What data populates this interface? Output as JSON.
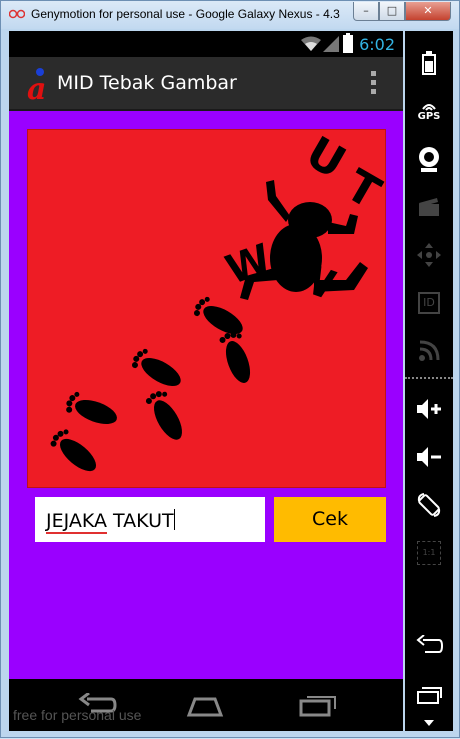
{
  "window": {
    "title": "Genymotion for personal use - Google Galaxy Nexus - 4.3",
    "min_label": "–",
    "max_label": "□",
    "close_label": "✕"
  },
  "statusbar": {
    "time": "6:02",
    "accent_color": "#33b5e5"
  },
  "actionbar": {
    "app_title": "MID Tebak Gambar",
    "logo_letter": "a"
  },
  "content": {
    "background_color": "#9a00ff",
    "picture_background": "#ee1c25",
    "picture_letters": [
      "U",
      "T",
      "W",
      "W"
    ],
    "answer_text_misspelled": "JEJAKA",
    "answer_text_rest": " TAKUT",
    "check_button_label": "Cek",
    "check_button_color": "#ffbb00"
  },
  "navbar": {
    "buttons": [
      "back-icon",
      "home-icon",
      "recent-apps-icon"
    ]
  },
  "watermark": "free for personal use",
  "sidebar": {
    "items": [
      {
        "icon": "battery-icon"
      },
      {
        "icon": "gps-icon",
        "label": "GPS"
      },
      {
        "icon": "camera-icon"
      },
      {
        "icon": "clapperboard-icon"
      },
      {
        "icon": "dpad-icon"
      },
      {
        "icon": "id-icon",
        "label": "ID"
      },
      {
        "icon": "cast-icon"
      },
      {
        "icon": "volume-up-icon"
      },
      {
        "icon": "volume-down-icon"
      },
      {
        "icon": "rotate-icon"
      },
      {
        "icon": "scale-icon",
        "label": "1:1"
      },
      {
        "icon": "back-icon"
      },
      {
        "icon": "recent-apps-icon"
      },
      {
        "icon": "menu-icon"
      }
    ]
  }
}
